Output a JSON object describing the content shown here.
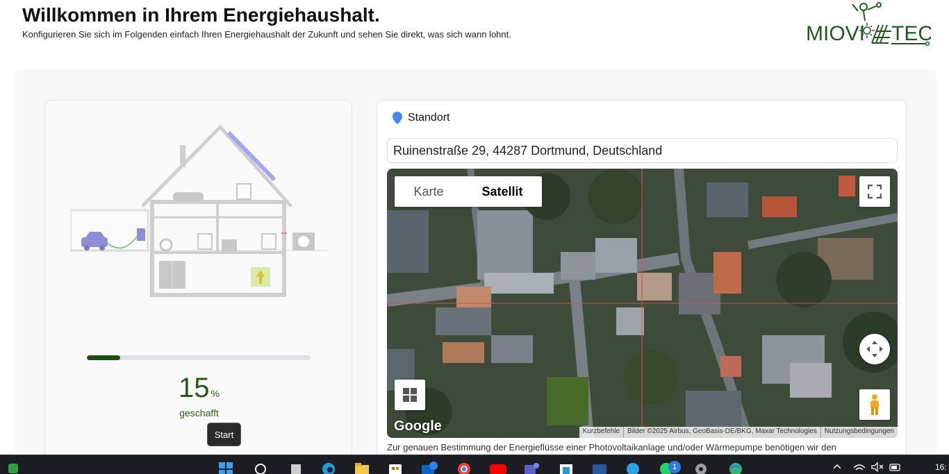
{
  "header": {
    "title": "Willkommen in Ihrem Energiehaushalt.",
    "subtitle": "Konfigurieren Sie sich im Folgenden einfach Ihren Energiehaushalt der Zukunft und sehen Sie direkt, was sich wann lohnt.",
    "logo_text_left": "MIOVI",
    "logo_text_right": "TEC"
  },
  "progress": {
    "value": 15,
    "fraction": 0.15,
    "unit": "%",
    "label": "geschafft"
  },
  "tooltip": {
    "label": "Start"
  },
  "location": {
    "heading": "Standort",
    "address": "Ruinenstraße 29, 44287 Dortmund, Deutschland"
  },
  "map": {
    "type_options": [
      "Karte",
      "Satellit"
    ],
    "selected_type": "Satellit",
    "google_label": "Google",
    "attribution": [
      "Kurzbefehle",
      "Bilder ©2025 Airbus, GeoBasis-DE/BKG, Maxar Technologies",
      "Nutzungsbedingungen"
    ],
    "caption": "Zur genauen Bestimmung der Energieflüsse einer Photovoltaikanlage und/oder Wärmepumpe benötigen wir den"
  },
  "taskbar": {
    "notification_count": "1",
    "time": "16:"
  },
  "colors": {
    "brand_green": "#1e4d12",
    "text_green": "#2a5a18",
    "accent_blue": "#4285f4",
    "house_gray": "#c8c8c8",
    "ev_purple": "#8f8fd8"
  }
}
